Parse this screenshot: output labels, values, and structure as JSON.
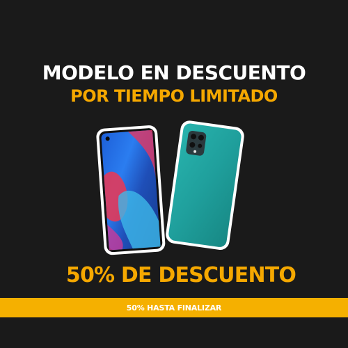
{
  "headline": {
    "line1": "MODELO EN DESCUENTO",
    "line2": "POR TIEMPO LIMITADO"
  },
  "offer": {
    "discount_text": "50% DE DESCUENTO"
  },
  "bar": {
    "text": "50% HASTA FINALIZAR"
  },
  "colors": {
    "background": "#1a1a1a",
    "accent": "#f5a800",
    "bar": "#f5b000",
    "phone_back": "#1fa3a0"
  },
  "images": {
    "front_phone": "smartphone-front-icon",
    "back_phone": "smartphone-back-icon"
  }
}
